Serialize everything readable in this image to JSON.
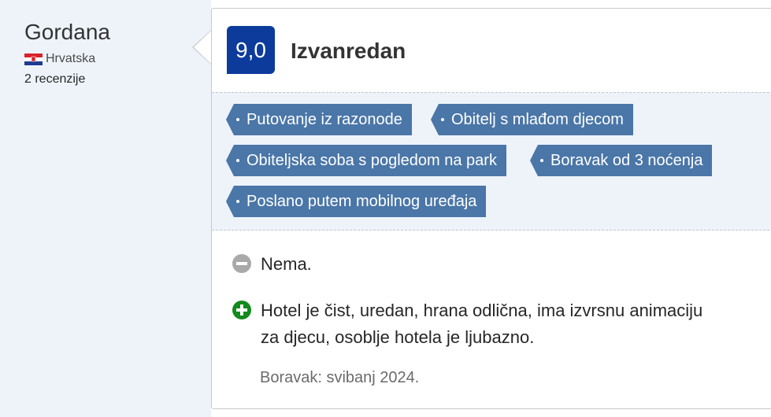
{
  "reviewer": {
    "name": "Gordana",
    "country": "Hrvatska",
    "review_count": "2 recenzije"
  },
  "review": {
    "score": "9,0",
    "rating_word": "Izvanredan",
    "tags": [
      "Putovanje iz razonode",
      "Obitelj s mlađom djecom",
      "Obiteljska soba s pogledom na park",
      "Boravak od 3 noćenja",
      "Poslano putem mobilnog uređaja"
    ],
    "negative": "Nema.",
    "positive_line1": "Hotel je čist, uredan, hrana odlična, ima izvrsnu animaciju",
    "positive_line2": "za djecu, osoblje hotela je ljubazno.",
    "stay": "Boravak: svibanj 2024."
  },
  "colors": {
    "score_bg": "#0c3b9c",
    "tag_bg": "#4a76a8",
    "positive_icon": "#138a1e",
    "negative_icon": "#a9a9a9"
  },
  "icons": {
    "flag": "croatia-flag-icon",
    "negative": "minus-circle-icon",
    "positive": "plus-circle-icon"
  }
}
